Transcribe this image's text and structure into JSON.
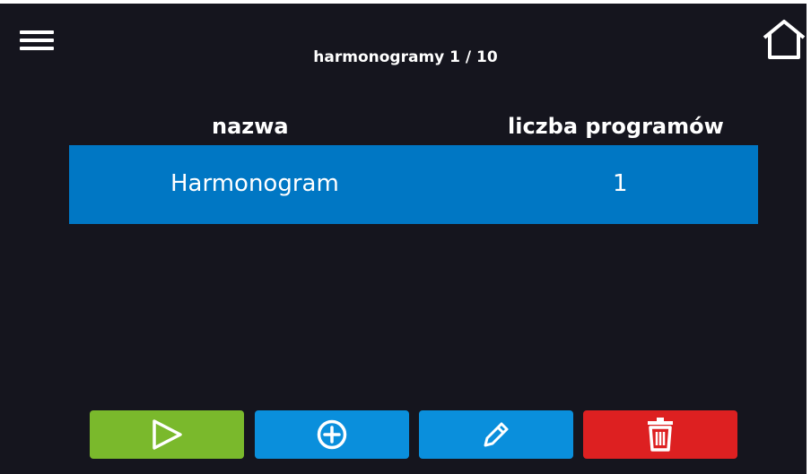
{
  "header": {
    "title": "harmonogramy 1 / 10"
  },
  "table": {
    "columns": [
      "nazwa",
      "liczba programów"
    ],
    "rows": [
      {
        "name": "Harmonogram",
        "count": "1"
      }
    ]
  },
  "toolbar": {
    "buttons": [
      {
        "icon": "play-icon",
        "color": "#7ab92c"
      },
      {
        "icon": "plus-circle-icon",
        "color": "#0a8fdc"
      },
      {
        "icon": "pencil-icon",
        "color": "#0a8fdc"
      },
      {
        "icon": "trash-icon",
        "color": "#dd2021"
      }
    ]
  },
  "icons": {
    "menu": "hamburger-menu-icon",
    "home": "home-icon"
  },
  "colors": {
    "background": "#15151e",
    "row_highlight": "#0077c4",
    "text": "#ffffff"
  }
}
